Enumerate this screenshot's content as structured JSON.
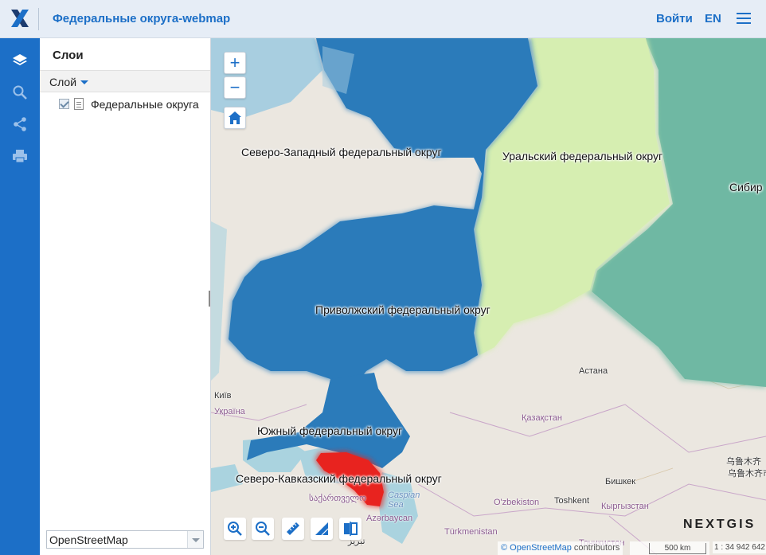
{
  "header": {
    "title": "Федеральные округа-webmap",
    "login_label": "Войти",
    "lang_label": "EN",
    "logo_icon": "nextgis-x-logo",
    "menu_icon": "hamburger-menu-icon",
    "accent_color": "#1c6fc7"
  },
  "toolbar": {
    "items": [
      {
        "icon": "layers-icon",
        "active": true
      },
      {
        "icon": "search-icon"
      },
      {
        "icon": "share-icon"
      },
      {
        "icon": "print-icon"
      }
    ]
  },
  "layers_panel": {
    "title": "Слои",
    "header_label": "Слой",
    "layers": [
      {
        "label": "Федеральные округа",
        "checked": true
      }
    ],
    "basemap": "OpenStreetMap"
  },
  "map": {
    "district_labels": [
      "Северо-Западный федеральный округ",
      "Уральский федеральный округ",
      "Сибир",
      "Приволжский федеральный округ",
      "Южный федеральный округ",
      "Северо-Кавказский федеральный округ"
    ],
    "district_colors": {
      "northwest": "#2b7bba",
      "volga": "#2b7bba",
      "south": "#2b7bba",
      "urals": "#d6eeb1",
      "siberia": "#6fb8a3",
      "north_caucasus": "#e8231f"
    },
    "places": {
      "kyiv": "Київ",
      "ukraine": "Україна",
      "astana": "Астана",
      "kazakhstan": "Қазақстан",
      "bishkek": "Бишкек",
      "kyrgyzstan": "Кыргызстан",
      "uzbekistan": "O'zbekiston",
      "tashkent": "Toshkent",
      "turkmenistan": "Türkmenistan",
      "azerbaijan": "Azərbaycan",
      "georgia": "საქართველო",
      "caspian": "Caspian Sea",
      "urumqi": "乌鲁木齐",
      "urumqi2": "乌鲁木齐市",
      "tabriz": "تبریز",
      "tajikistan": "Тоҷикистон"
    },
    "zoom_in": "+",
    "zoom_out": "−",
    "home_icon": "home-icon",
    "bottom_tools": [
      "zoom-in-tool-icon",
      "zoom-out-tool-icon",
      "ruler-icon",
      "measure-area-icon",
      "identify-icon"
    ],
    "brand": "NEXTGIS",
    "attribution_osm": "© OpenStreetMap",
    "attribution_rest": "contributors",
    "scale_label": "500 km",
    "scale_ratio": "1 : 34 942 642"
  }
}
